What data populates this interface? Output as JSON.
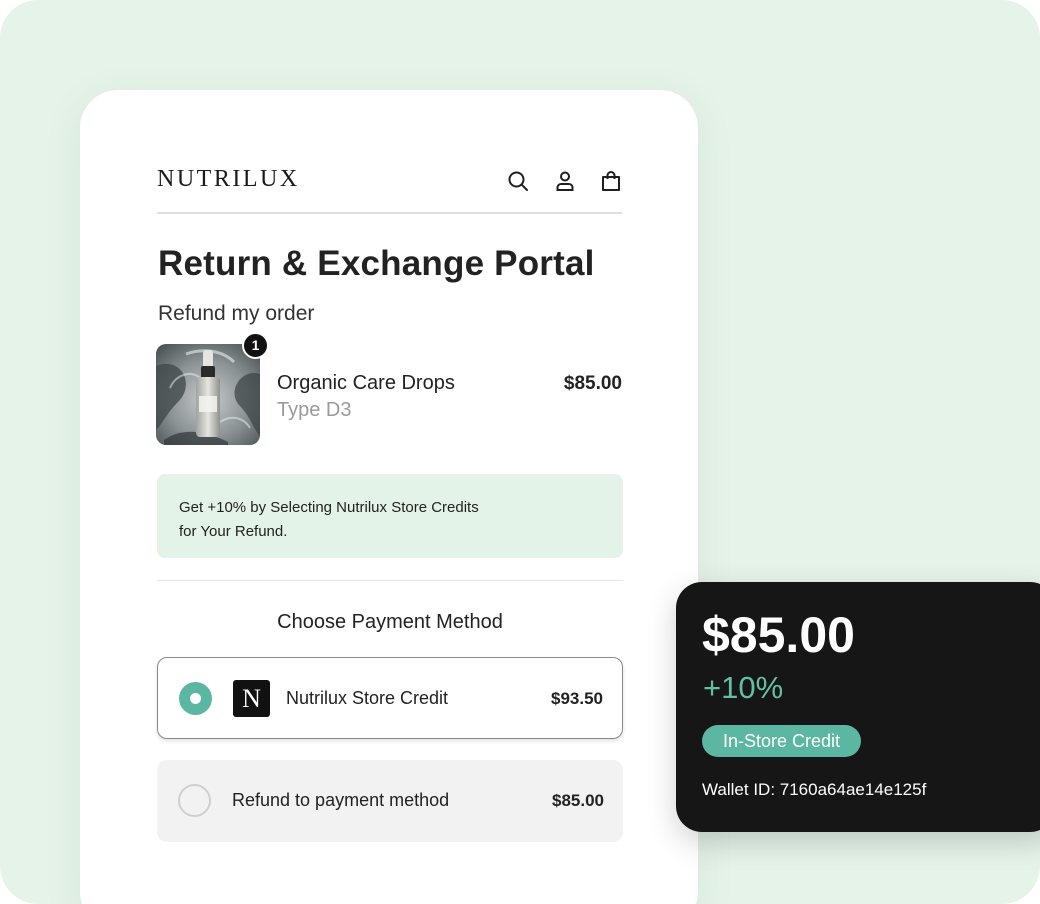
{
  "brand": "NUTRILUX",
  "header": {
    "icons": [
      "search-icon",
      "user-icon",
      "bag-icon"
    ]
  },
  "page": {
    "title": "Return & Exchange Portal",
    "subtitle": "Refund my order"
  },
  "product": {
    "quantity": "1",
    "name": "Organic Care Drops",
    "variant": "Type D3",
    "price": "$85.00"
  },
  "promo": {
    "line1": "Get +10% by Selecting Nutrilux Store Credits",
    "line2": "for Your Refund."
  },
  "payment": {
    "title": "Choose Payment Method",
    "options": [
      {
        "label": "Nutrilux Store Credit",
        "price": "$93.50",
        "selected": true,
        "logo": "N"
      },
      {
        "label": "Refund to payment method",
        "price": "$85.00",
        "selected": false
      }
    ]
  },
  "wallet": {
    "amount": "$85.00",
    "bonus": "+10%",
    "pill": "In-Store Credit",
    "id_text": "Wallet ID: 7160a64ae14e125f"
  },
  "colors": {
    "backdrop": "#e5f3e9",
    "accent": "#5bb7a2",
    "promo_bg": "#e4f3e7",
    "wallet_bg": "#161616"
  }
}
